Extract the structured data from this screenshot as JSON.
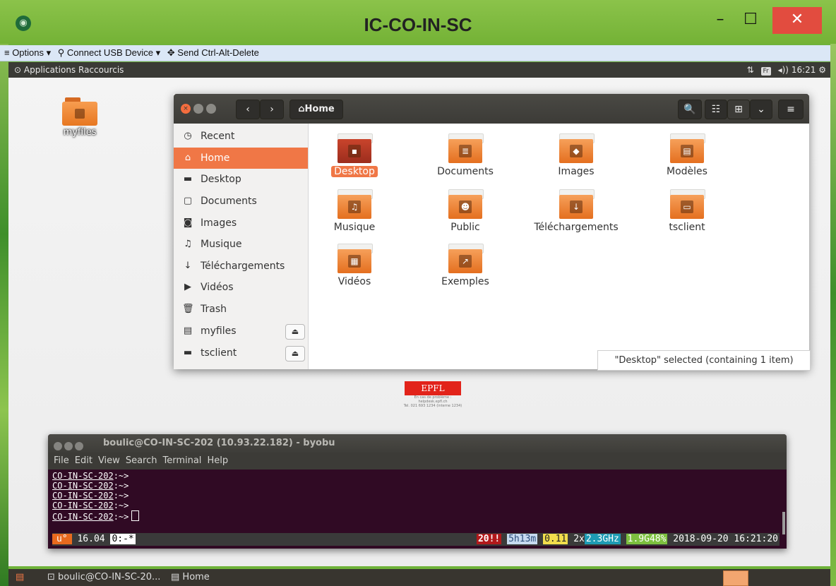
{
  "window": {
    "title": "IC-CO-IN-SC",
    "icon": "remote-viewer-icon",
    "min_glyph": "–",
    "max_glyph": "☐",
    "close_glyph": "✕"
  },
  "toolbar": {
    "options": "≡ Options ▾",
    "usb": "⚲ Connect USB Device ▾",
    "ctrl": "✥ Send Ctrl-Alt-Delete"
  },
  "topbar": {
    "applications": "⊙ Applications",
    "raccourcis": "Raccourcis",
    "net": "⇅",
    "kbd": "Fr",
    "volume": "◂))",
    "time": "16:21",
    "power": "⚙"
  },
  "desktop_icon": {
    "label": "myfiles"
  },
  "filemanager": {
    "path_label": "⌂Home",
    "back": "‹",
    "forward": "›",
    "search": "🔍",
    "list": "☷",
    "grid": "⊞",
    "sort": "⌄",
    "menu": "≡",
    "sidebar": [
      {
        "icon": "◷",
        "label": "Recent"
      },
      {
        "icon": "⌂",
        "label": "Home"
      },
      {
        "icon": "▬",
        "label": "Desktop"
      },
      {
        "icon": "▢",
        "label": "Documents"
      },
      {
        "icon": "◙",
        "label": "Images"
      },
      {
        "icon": "♫",
        "label": "Musique"
      },
      {
        "icon": "↓",
        "label": "Téléchargements"
      },
      {
        "icon": "▶",
        "label": "Vidéos"
      },
      {
        "icon": "🗑",
        "label": "Trash"
      },
      {
        "icon": "▤",
        "label": "myfiles"
      },
      {
        "icon": "▬",
        "label": "tsclient"
      }
    ],
    "eject": "⏏",
    "items": [
      {
        "label": "Desktop",
        "glyph": "▪"
      },
      {
        "label": "Documents",
        "glyph": "≣"
      },
      {
        "label": "Images",
        "glyph": "◆"
      },
      {
        "label": "Modèles",
        "glyph": "▤"
      },
      {
        "label": "Musique",
        "glyph": "♫"
      },
      {
        "label": "Public",
        "glyph": "☻"
      },
      {
        "label": "Téléchargements",
        "glyph": "↓"
      },
      {
        "label": "tsclient",
        "glyph": "▭"
      },
      {
        "label": "Vidéos",
        "glyph": "▦"
      },
      {
        "label": "Exemples",
        "glyph": "↗"
      }
    ],
    "status": "\"Desktop\" selected (containing 1 item)"
  },
  "epfl": {
    "logo": "EPFL",
    "l1": "En cas de problème :",
    "l2": "helpdesk.epfl.ch",
    "l3": "Tel. 021 693 1234 (interne 1234)"
  },
  "terminal": {
    "title": "boulic@CO-IN-SC-202 (10.93.22.182) - byobu",
    "menu": [
      "File",
      "Edit",
      "View",
      "Search",
      "Terminal",
      "Help"
    ],
    "prompt_host": "CO-IN-SC-202",
    "prompt_suffix": ":~>",
    "status": {
      "u": "u°",
      "ver": "16.04",
      "win": "0:-*",
      "warn": "20!!",
      "uptime": "5h13m",
      "load": "0.11",
      "cpu_prefix": "2x",
      "cpu": "2.3GHz",
      "mem": "1.9G48%",
      "datetime": "2018-09-20 16:21:20"
    }
  },
  "taskbar": {
    "menu_glyph": "▤",
    "term_label": "⊡ boulic@CO-IN-SC-20...",
    "home_label": "▤ Home"
  }
}
